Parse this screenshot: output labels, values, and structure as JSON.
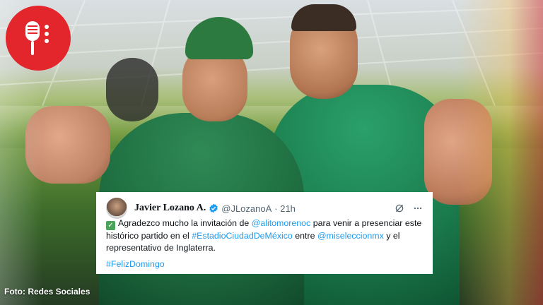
{
  "tweet": {
    "name": "Javier Lozano A.",
    "handle": "@JLozanoA",
    "time": "· 21h",
    "text_parts": {
      "p1": "Agradezco mucho la invitación de ",
      "mention1": "@alitomorenoc",
      "p2": " para venir a presenciar este histórico partido en el ",
      "hashtag1": "#EstadioCiudadDeMéxico",
      "p3": " entre ",
      "mention2": "@miseleccionmx",
      "p4": " y el representativo de Inglaterra."
    },
    "hashtag2": "#FelizDomingo",
    "icons": {
      "verified": "verified-badge-icon",
      "grok": "grok-icon",
      "more": "more-icon",
      "check": "check-mark-icon"
    }
  },
  "credit": "Foto: Redes Sociales",
  "logo": {
    "icon": "microphone-icon",
    "color": "#e3262b"
  },
  "colors": {
    "link": "#1d9bf0",
    "verified": "#1d9bf0"
  }
}
